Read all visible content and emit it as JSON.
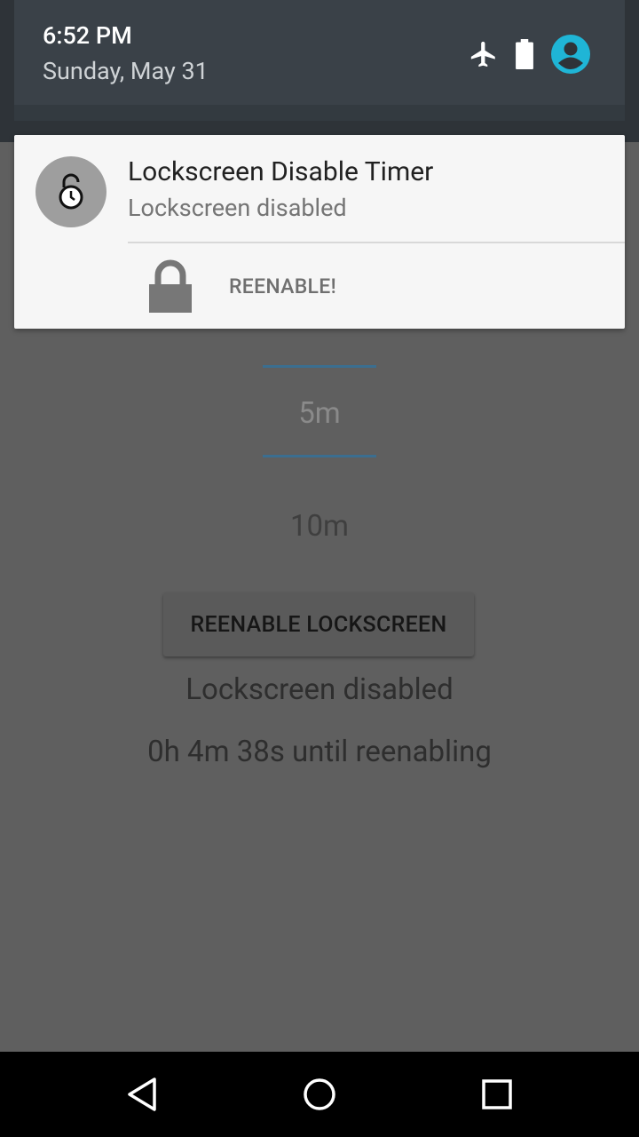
{
  "status": {
    "time": "6:52 PM",
    "date": "Sunday, May 31",
    "icons": [
      "airplane-icon",
      "battery-icon",
      "account-icon"
    ],
    "accent": "#1fb5d6"
  },
  "notification": {
    "app_icon": "lock-timer-icon",
    "title": "Lockscreen Disable Timer",
    "text": "Lockscreen disabled",
    "action": {
      "icon": "lock-icon",
      "label": "REENABLE!"
    }
  },
  "picker": {
    "selected": "5m",
    "next": "10m",
    "accent": "#3b6e90"
  },
  "main": {
    "button_label": "REENABLE LOCKSCREEN",
    "status": "Lockscreen disabled",
    "countdown": "0h 4m 38s until reenabling"
  },
  "nav": {
    "back": "back-icon",
    "home": "home-icon",
    "recents": "recents-icon"
  }
}
